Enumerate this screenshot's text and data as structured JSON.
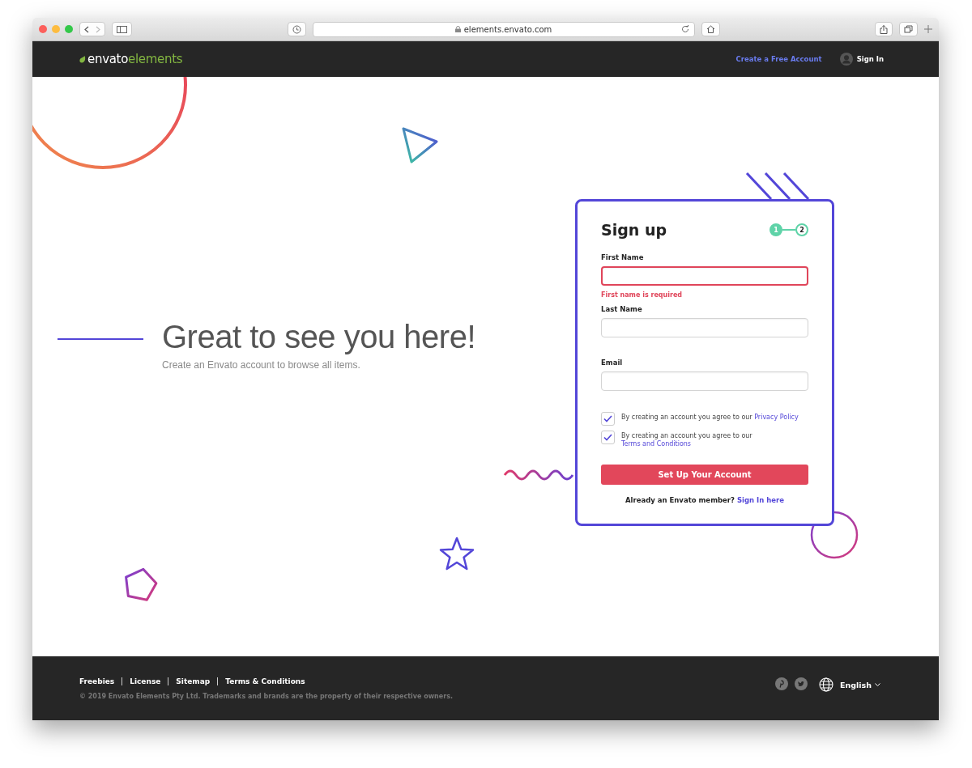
{
  "browser": {
    "url": "elements.envato.com"
  },
  "nav": {
    "logo_primary": "envato",
    "logo_secondary": "elements",
    "create_account": "Create a Free Account",
    "sign_in": "Sign In"
  },
  "hero": {
    "title": "Great to see you here!",
    "subtitle": "Create an Envato account to browse all items."
  },
  "signup": {
    "title": "Sign up",
    "steps": [
      {
        "label": "1",
        "selected": true
      },
      {
        "label": "2",
        "selected": false
      }
    ],
    "fields": [
      {
        "label": "First Name",
        "error": "First name is required",
        "invalid": true
      },
      {
        "label": "Last Name",
        "invalid": false
      },
      {
        "label": "Email",
        "invalid": false
      }
    ],
    "agreements": [
      {
        "text": "By creating an account you agree to our ",
        "link": "Privacy Policy",
        "checked": true
      },
      {
        "text": "By creating an account you agree to our ",
        "link": "Terms and Conditions",
        "checked": true
      }
    ],
    "submit": "Set Up Your Account",
    "member_text": "Already an Envato member? ",
    "member_link": "Sign In here"
  },
  "footer": {
    "links": [
      "Freebies",
      "License",
      "Sitemap",
      "Terms & Conditions"
    ],
    "copyright": "© 2019 Envato Elements Pty Ltd. Trademarks and brands are the property of their respective owners.",
    "language": "English"
  }
}
